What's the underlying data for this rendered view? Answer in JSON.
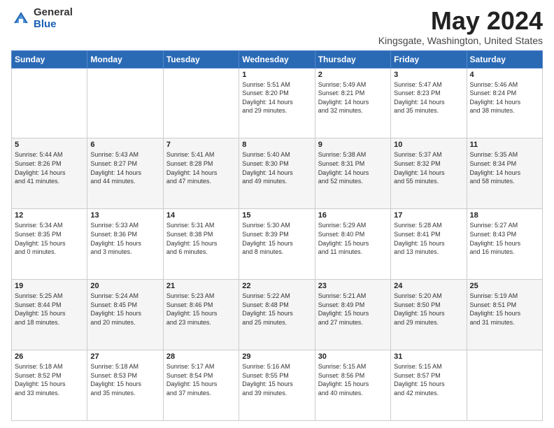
{
  "logo": {
    "general": "General",
    "blue": "Blue"
  },
  "title": "May 2024",
  "subtitle": "Kingsgate, Washington, United States",
  "weekdays": [
    "Sunday",
    "Monday",
    "Tuesday",
    "Wednesday",
    "Thursday",
    "Friday",
    "Saturday"
  ],
  "weeks": [
    [
      {
        "day": "",
        "info": ""
      },
      {
        "day": "",
        "info": ""
      },
      {
        "day": "",
        "info": ""
      },
      {
        "day": "1",
        "info": "Sunrise: 5:51 AM\nSunset: 8:20 PM\nDaylight: 14 hours\nand 29 minutes."
      },
      {
        "day": "2",
        "info": "Sunrise: 5:49 AM\nSunset: 8:21 PM\nDaylight: 14 hours\nand 32 minutes."
      },
      {
        "day": "3",
        "info": "Sunrise: 5:47 AM\nSunset: 8:23 PM\nDaylight: 14 hours\nand 35 minutes."
      },
      {
        "day": "4",
        "info": "Sunrise: 5:46 AM\nSunset: 8:24 PM\nDaylight: 14 hours\nand 38 minutes."
      }
    ],
    [
      {
        "day": "5",
        "info": "Sunrise: 5:44 AM\nSunset: 8:26 PM\nDaylight: 14 hours\nand 41 minutes."
      },
      {
        "day": "6",
        "info": "Sunrise: 5:43 AM\nSunset: 8:27 PM\nDaylight: 14 hours\nand 44 minutes."
      },
      {
        "day": "7",
        "info": "Sunrise: 5:41 AM\nSunset: 8:28 PM\nDaylight: 14 hours\nand 47 minutes."
      },
      {
        "day": "8",
        "info": "Sunrise: 5:40 AM\nSunset: 8:30 PM\nDaylight: 14 hours\nand 49 minutes."
      },
      {
        "day": "9",
        "info": "Sunrise: 5:38 AM\nSunset: 8:31 PM\nDaylight: 14 hours\nand 52 minutes."
      },
      {
        "day": "10",
        "info": "Sunrise: 5:37 AM\nSunset: 8:32 PM\nDaylight: 14 hours\nand 55 minutes."
      },
      {
        "day": "11",
        "info": "Sunrise: 5:35 AM\nSunset: 8:34 PM\nDaylight: 14 hours\nand 58 minutes."
      }
    ],
    [
      {
        "day": "12",
        "info": "Sunrise: 5:34 AM\nSunset: 8:35 PM\nDaylight: 15 hours\nand 0 minutes."
      },
      {
        "day": "13",
        "info": "Sunrise: 5:33 AM\nSunset: 8:36 PM\nDaylight: 15 hours\nand 3 minutes."
      },
      {
        "day": "14",
        "info": "Sunrise: 5:31 AM\nSunset: 8:38 PM\nDaylight: 15 hours\nand 6 minutes."
      },
      {
        "day": "15",
        "info": "Sunrise: 5:30 AM\nSunset: 8:39 PM\nDaylight: 15 hours\nand 8 minutes."
      },
      {
        "day": "16",
        "info": "Sunrise: 5:29 AM\nSunset: 8:40 PM\nDaylight: 15 hours\nand 11 minutes."
      },
      {
        "day": "17",
        "info": "Sunrise: 5:28 AM\nSunset: 8:41 PM\nDaylight: 15 hours\nand 13 minutes."
      },
      {
        "day": "18",
        "info": "Sunrise: 5:27 AM\nSunset: 8:43 PM\nDaylight: 15 hours\nand 16 minutes."
      }
    ],
    [
      {
        "day": "19",
        "info": "Sunrise: 5:25 AM\nSunset: 8:44 PM\nDaylight: 15 hours\nand 18 minutes."
      },
      {
        "day": "20",
        "info": "Sunrise: 5:24 AM\nSunset: 8:45 PM\nDaylight: 15 hours\nand 20 minutes."
      },
      {
        "day": "21",
        "info": "Sunrise: 5:23 AM\nSunset: 8:46 PM\nDaylight: 15 hours\nand 23 minutes."
      },
      {
        "day": "22",
        "info": "Sunrise: 5:22 AM\nSunset: 8:48 PM\nDaylight: 15 hours\nand 25 minutes."
      },
      {
        "day": "23",
        "info": "Sunrise: 5:21 AM\nSunset: 8:49 PM\nDaylight: 15 hours\nand 27 minutes."
      },
      {
        "day": "24",
        "info": "Sunrise: 5:20 AM\nSunset: 8:50 PM\nDaylight: 15 hours\nand 29 minutes."
      },
      {
        "day": "25",
        "info": "Sunrise: 5:19 AM\nSunset: 8:51 PM\nDaylight: 15 hours\nand 31 minutes."
      }
    ],
    [
      {
        "day": "26",
        "info": "Sunrise: 5:18 AM\nSunset: 8:52 PM\nDaylight: 15 hours\nand 33 minutes."
      },
      {
        "day": "27",
        "info": "Sunrise: 5:18 AM\nSunset: 8:53 PM\nDaylight: 15 hours\nand 35 minutes."
      },
      {
        "day": "28",
        "info": "Sunrise: 5:17 AM\nSunset: 8:54 PM\nDaylight: 15 hours\nand 37 minutes."
      },
      {
        "day": "29",
        "info": "Sunrise: 5:16 AM\nSunset: 8:55 PM\nDaylight: 15 hours\nand 39 minutes."
      },
      {
        "day": "30",
        "info": "Sunrise: 5:15 AM\nSunset: 8:56 PM\nDaylight: 15 hours\nand 40 minutes."
      },
      {
        "day": "31",
        "info": "Sunrise: 5:15 AM\nSunset: 8:57 PM\nDaylight: 15 hours\nand 42 minutes."
      },
      {
        "day": "",
        "info": ""
      }
    ]
  ]
}
